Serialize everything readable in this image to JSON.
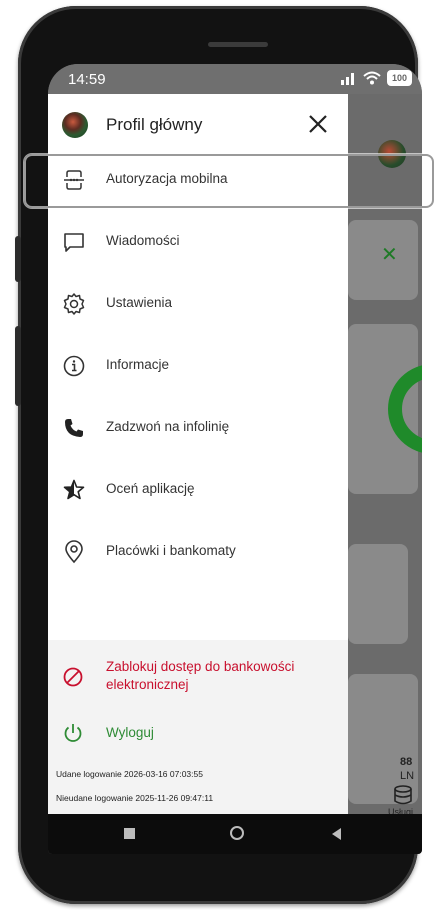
{
  "status_bar": {
    "time": "14:59",
    "battery": "100"
  },
  "drawer": {
    "profile_title": "Profil główny",
    "menu_items": [
      {
        "label": "Autoryzacja mobilna",
        "icon": "mobile-auth-icon"
      },
      {
        "label": "Wiadomości",
        "icon": "message-icon"
      },
      {
        "label": "Ustawienia",
        "icon": "gear-icon"
      },
      {
        "label": "Informacje",
        "icon": "info-icon"
      },
      {
        "label": "Zadzwoń na infolinię",
        "icon": "phone-icon"
      },
      {
        "label": "Oceń aplikację",
        "icon": "star-icon"
      },
      {
        "label": "Placówki i bankomaty",
        "icon": "location-icon"
      }
    ],
    "block_access": "Zablokuj dostęp do bankowości elektronicznej",
    "logout": "Wyloguj",
    "last_login_success": "Udane logowanie 2026-03-16 07:03:55",
    "last_login_failed": "Nieudane logowanie 2025-11-26 09:47:11"
  },
  "background_app": {
    "amount_partial": "88",
    "currency_partial": "LN",
    "services_label": "Usługi"
  },
  "colors": {
    "accent_green": "#2e8b35",
    "danger_red": "#c8102e"
  }
}
